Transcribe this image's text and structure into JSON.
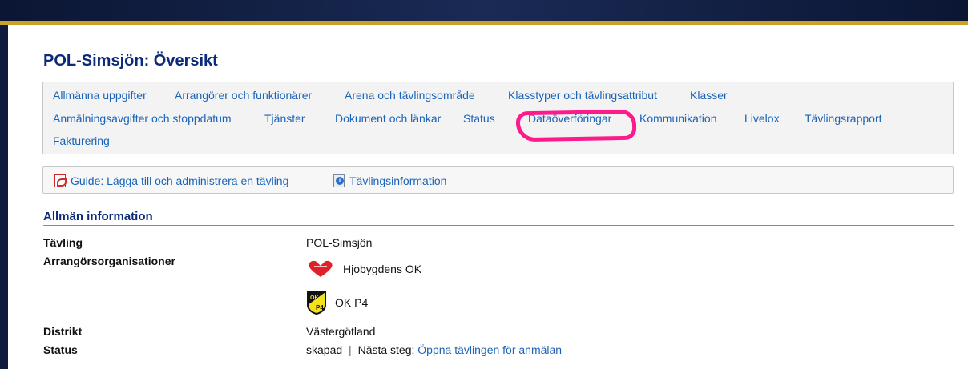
{
  "page": {
    "title": "POL-Simsjön: Översikt"
  },
  "tabs": [
    "Allmänna uppgifter",
    "Arrangörer och funktionärer",
    "Arena och tävlingsområde",
    "Klasstyper och tävlingsattribut",
    "Klasser",
    "Anmälningsavgifter och stoppdatum",
    "Tjänster",
    "Dokument och länkar",
    "Status",
    "Dataöverföringar",
    "Kommunikation",
    "Livelox",
    "Tävlingsrapport",
    "Fakturering"
  ],
  "guide": {
    "guide_label": "Guide: Lägga till och administrera en tävling",
    "info_label": "Tävlingsinformation"
  },
  "section": {
    "title": "Allmän information"
  },
  "rows": {
    "competition_label": "Tävling",
    "competition_value": "POL-Simsjön",
    "organizers_label": "Arrangörsorganisationer",
    "organizers": [
      "Hjobygdens OK",
      "OK P4"
    ],
    "district_label": "Distrikt",
    "district_value": "Västergötland",
    "status_label": "Status",
    "status_value": "skapad",
    "status_separator": "|",
    "next_step_label": "Nästa steg:",
    "next_step_link": "Öppna tävlingen för anmälan"
  },
  "icons": {
    "pdf": "pdf-icon",
    "info": "info-icon"
  },
  "colors": {
    "link": "#1a63b8",
    "title": "#0c2a7a",
    "highlight": "#ff1a8c",
    "header_bg": "#0f1b3d",
    "gold": "#c9a227"
  }
}
